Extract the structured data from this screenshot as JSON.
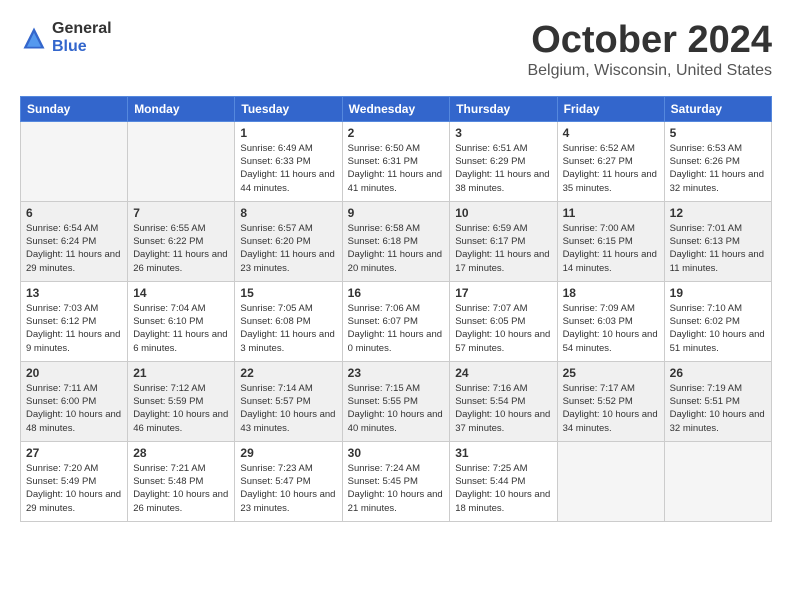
{
  "header": {
    "logo": {
      "general": "General",
      "blue": "Blue"
    },
    "title": "October 2024",
    "location": "Belgium, Wisconsin, United States"
  },
  "calendar": {
    "days_of_week": [
      "Sunday",
      "Monday",
      "Tuesday",
      "Wednesday",
      "Thursday",
      "Friday",
      "Saturday"
    ],
    "weeks": [
      [
        {
          "day": "",
          "sunrise": "",
          "sunset": "",
          "daylight": "",
          "empty": true
        },
        {
          "day": "",
          "sunrise": "",
          "sunset": "",
          "daylight": "",
          "empty": true
        },
        {
          "day": "1",
          "sunrise": "Sunrise: 6:49 AM",
          "sunset": "Sunset: 6:33 PM",
          "daylight": "Daylight: 11 hours and 44 minutes."
        },
        {
          "day": "2",
          "sunrise": "Sunrise: 6:50 AM",
          "sunset": "Sunset: 6:31 PM",
          "daylight": "Daylight: 11 hours and 41 minutes."
        },
        {
          "day": "3",
          "sunrise": "Sunrise: 6:51 AM",
          "sunset": "Sunset: 6:29 PM",
          "daylight": "Daylight: 11 hours and 38 minutes."
        },
        {
          "day": "4",
          "sunrise": "Sunrise: 6:52 AM",
          "sunset": "Sunset: 6:27 PM",
          "daylight": "Daylight: 11 hours and 35 minutes."
        },
        {
          "day": "5",
          "sunrise": "Sunrise: 6:53 AM",
          "sunset": "Sunset: 6:26 PM",
          "daylight": "Daylight: 11 hours and 32 minutes."
        }
      ],
      [
        {
          "day": "6",
          "sunrise": "Sunrise: 6:54 AM",
          "sunset": "Sunset: 6:24 PM",
          "daylight": "Daylight: 11 hours and 29 minutes."
        },
        {
          "day": "7",
          "sunrise": "Sunrise: 6:55 AM",
          "sunset": "Sunset: 6:22 PM",
          "daylight": "Daylight: 11 hours and 26 minutes."
        },
        {
          "day": "8",
          "sunrise": "Sunrise: 6:57 AM",
          "sunset": "Sunset: 6:20 PM",
          "daylight": "Daylight: 11 hours and 23 minutes."
        },
        {
          "day": "9",
          "sunrise": "Sunrise: 6:58 AM",
          "sunset": "Sunset: 6:18 PM",
          "daylight": "Daylight: 11 hours and 20 minutes."
        },
        {
          "day": "10",
          "sunrise": "Sunrise: 6:59 AM",
          "sunset": "Sunset: 6:17 PM",
          "daylight": "Daylight: 11 hours and 17 minutes."
        },
        {
          "day": "11",
          "sunrise": "Sunrise: 7:00 AM",
          "sunset": "Sunset: 6:15 PM",
          "daylight": "Daylight: 11 hours and 14 minutes."
        },
        {
          "day": "12",
          "sunrise": "Sunrise: 7:01 AM",
          "sunset": "Sunset: 6:13 PM",
          "daylight": "Daylight: 11 hours and 11 minutes."
        }
      ],
      [
        {
          "day": "13",
          "sunrise": "Sunrise: 7:03 AM",
          "sunset": "Sunset: 6:12 PM",
          "daylight": "Daylight: 11 hours and 9 minutes."
        },
        {
          "day": "14",
          "sunrise": "Sunrise: 7:04 AM",
          "sunset": "Sunset: 6:10 PM",
          "daylight": "Daylight: 11 hours and 6 minutes."
        },
        {
          "day": "15",
          "sunrise": "Sunrise: 7:05 AM",
          "sunset": "Sunset: 6:08 PM",
          "daylight": "Daylight: 11 hours and 3 minutes."
        },
        {
          "day": "16",
          "sunrise": "Sunrise: 7:06 AM",
          "sunset": "Sunset: 6:07 PM",
          "daylight": "Daylight: 11 hours and 0 minutes."
        },
        {
          "day": "17",
          "sunrise": "Sunrise: 7:07 AM",
          "sunset": "Sunset: 6:05 PM",
          "daylight": "Daylight: 10 hours and 57 minutes."
        },
        {
          "day": "18",
          "sunrise": "Sunrise: 7:09 AM",
          "sunset": "Sunset: 6:03 PM",
          "daylight": "Daylight: 10 hours and 54 minutes."
        },
        {
          "day": "19",
          "sunrise": "Sunrise: 7:10 AM",
          "sunset": "Sunset: 6:02 PM",
          "daylight": "Daylight: 10 hours and 51 minutes."
        }
      ],
      [
        {
          "day": "20",
          "sunrise": "Sunrise: 7:11 AM",
          "sunset": "Sunset: 6:00 PM",
          "daylight": "Daylight: 10 hours and 48 minutes."
        },
        {
          "day": "21",
          "sunrise": "Sunrise: 7:12 AM",
          "sunset": "Sunset: 5:59 PM",
          "daylight": "Daylight: 10 hours and 46 minutes."
        },
        {
          "day": "22",
          "sunrise": "Sunrise: 7:14 AM",
          "sunset": "Sunset: 5:57 PM",
          "daylight": "Daylight: 10 hours and 43 minutes."
        },
        {
          "day": "23",
          "sunrise": "Sunrise: 7:15 AM",
          "sunset": "Sunset: 5:55 PM",
          "daylight": "Daylight: 10 hours and 40 minutes."
        },
        {
          "day": "24",
          "sunrise": "Sunrise: 7:16 AM",
          "sunset": "Sunset: 5:54 PM",
          "daylight": "Daylight: 10 hours and 37 minutes."
        },
        {
          "day": "25",
          "sunrise": "Sunrise: 7:17 AM",
          "sunset": "Sunset: 5:52 PM",
          "daylight": "Daylight: 10 hours and 34 minutes."
        },
        {
          "day": "26",
          "sunrise": "Sunrise: 7:19 AM",
          "sunset": "Sunset: 5:51 PM",
          "daylight": "Daylight: 10 hours and 32 minutes."
        }
      ],
      [
        {
          "day": "27",
          "sunrise": "Sunrise: 7:20 AM",
          "sunset": "Sunset: 5:49 PM",
          "daylight": "Daylight: 10 hours and 29 minutes."
        },
        {
          "day": "28",
          "sunrise": "Sunrise: 7:21 AM",
          "sunset": "Sunset: 5:48 PM",
          "daylight": "Daylight: 10 hours and 26 minutes."
        },
        {
          "day": "29",
          "sunrise": "Sunrise: 7:23 AM",
          "sunset": "Sunset: 5:47 PM",
          "daylight": "Daylight: 10 hours and 23 minutes."
        },
        {
          "day": "30",
          "sunrise": "Sunrise: 7:24 AM",
          "sunset": "Sunset: 5:45 PM",
          "daylight": "Daylight: 10 hours and 21 minutes."
        },
        {
          "day": "31",
          "sunrise": "Sunrise: 7:25 AM",
          "sunset": "Sunset: 5:44 PM",
          "daylight": "Daylight: 10 hours and 18 minutes."
        },
        {
          "day": "",
          "sunrise": "",
          "sunset": "",
          "daylight": "",
          "empty": true
        },
        {
          "day": "",
          "sunrise": "",
          "sunset": "",
          "daylight": "",
          "empty": true
        }
      ]
    ]
  }
}
